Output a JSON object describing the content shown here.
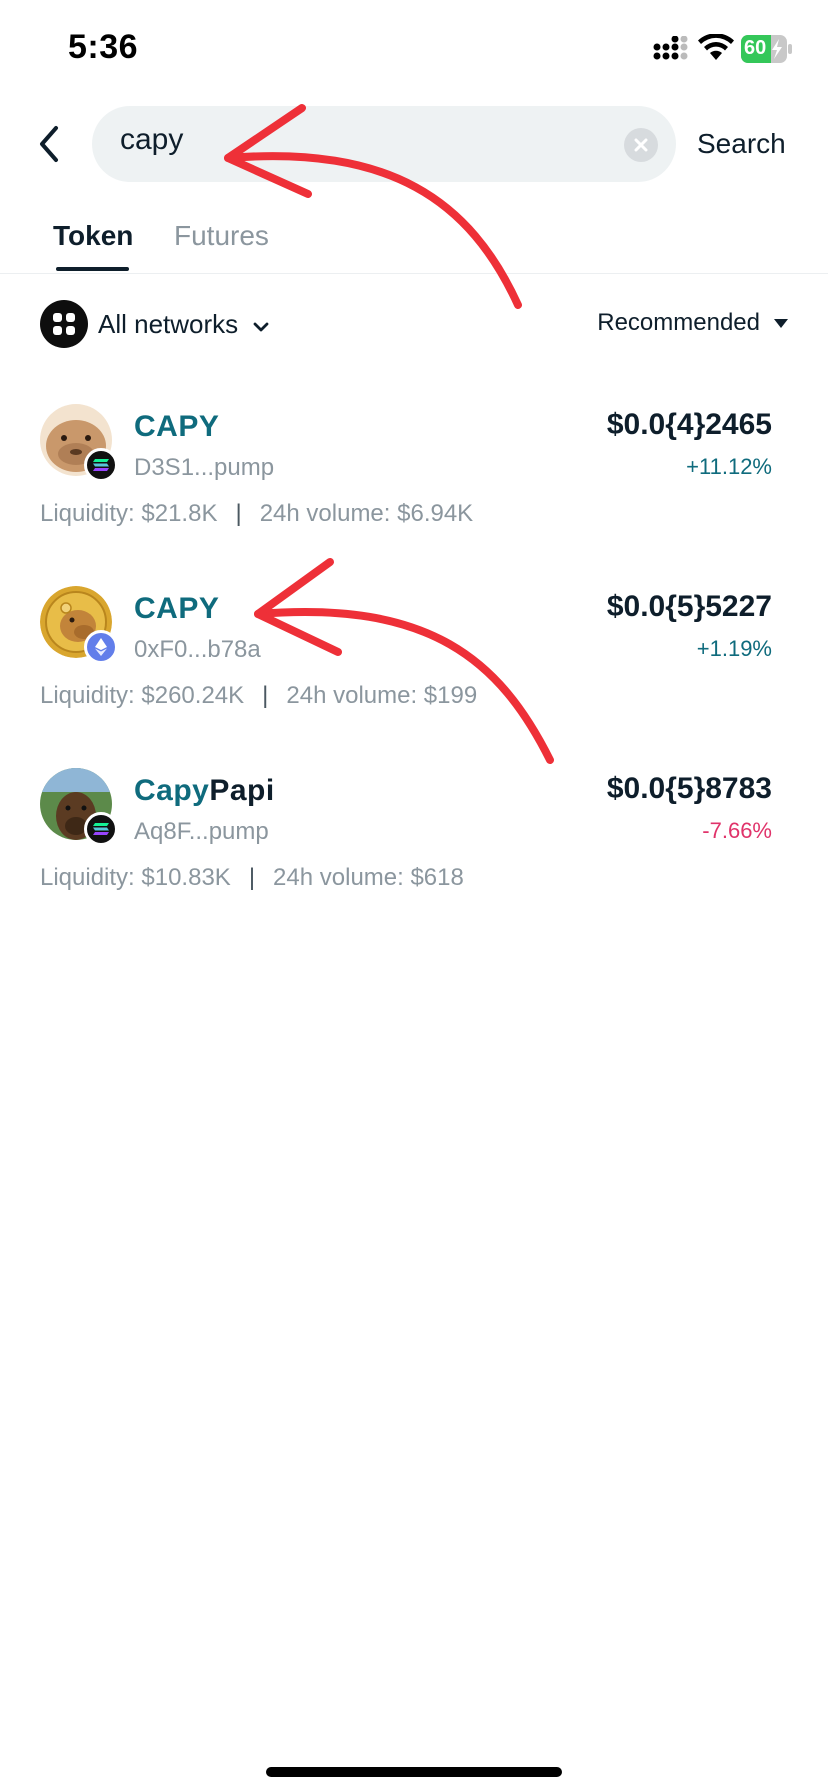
{
  "status_bar": {
    "time": "5:36",
    "battery": "60"
  },
  "search": {
    "value": "capy",
    "button_label": "Search"
  },
  "tabs": [
    {
      "label": "Token",
      "active": true
    },
    {
      "label": "Futures",
      "active": false
    }
  ],
  "filters": {
    "network_label": "All networks",
    "sort_label": "Recommended"
  },
  "tokens": [
    {
      "name_accent": "CAPY",
      "name_rest": "",
      "address": "D3S1...pump",
      "price": "$0.0{4}2465",
      "change": "+11.12%",
      "change_direction": "up",
      "liquidity": "Liquidity: $21.8K",
      "volume": "24h volume: $6.94K",
      "chain": "solana-icon"
    },
    {
      "name_accent": "CAPY",
      "name_rest": "",
      "address": "0xF0...b78a",
      "price": "$0.0{5}5227",
      "change": "+1.19%",
      "change_direction": "up",
      "liquidity": "Liquidity: $260.24K",
      "volume": "24h volume: $199",
      "chain": "ethereum-icon"
    },
    {
      "name_accent": "Capy",
      "name_rest": "Papi",
      "address": "Aq8F...pump",
      "price": "$0.0{5}8783",
      "change": "-7.66%",
      "change_direction": "down",
      "liquidity": "Liquidity: $10.83K",
      "volume": "24h volume: $618",
      "chain": "solana-icon"
    }
  ],
  "colors": {
    "accent": "#0f6b7d",
    "positive": "#0f6b7d",
    "negative": "#e0336a",
    "annotation_arrow": "#ee3038",
    "search_bg": "#eef2f3"
  }
}
